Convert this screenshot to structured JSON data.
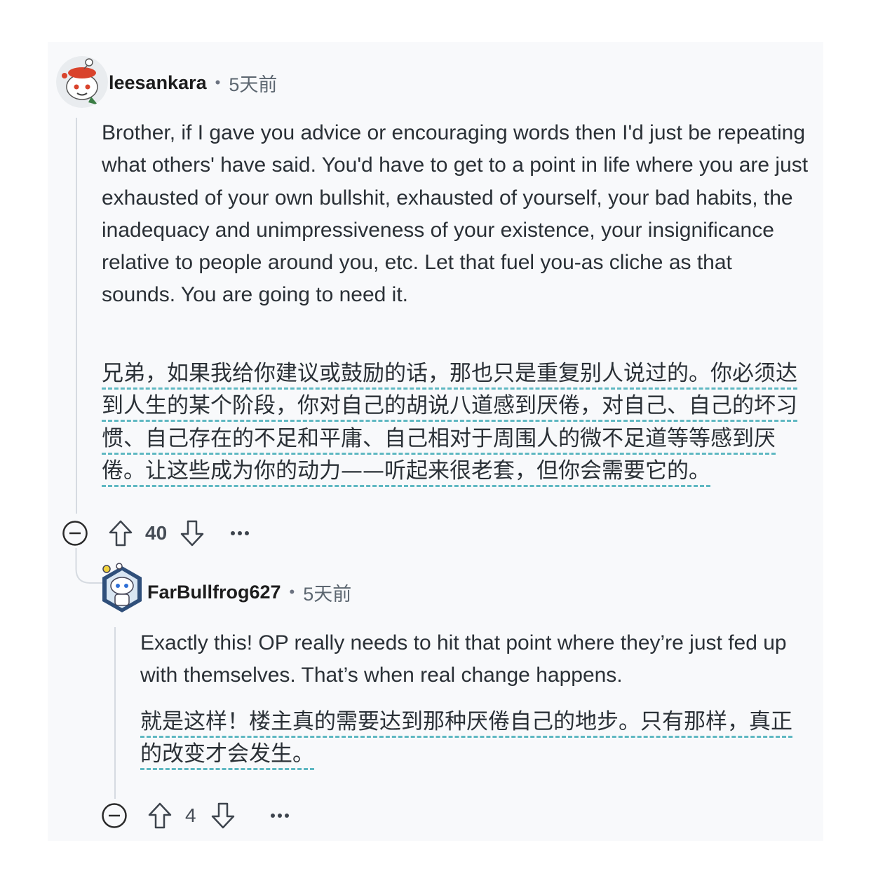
{
  "comments": [
    {
      "username": "leesankara",
      "separator": "•",
      "time": "5天前",
      "body_en": "Brother, if I gave you advice or encouraging words then I'd just be repeating what others' have said. You'd have to get to a point in life where you are just exhausted of your own bullshit, exhausted of yourself, your bad habits, the inadequacy and unimpressiveness of your existence, your insignificance relative to people around you, etc. Let that fuel you-as cliche as that sounds. You are going to need it.",
      "body_zh": "兄弟，如果我给你建议或鼓励的话，那也只是重复别人说过的。你必须达到人生的某个阶段，你对自己的胡说八道感到厌倦，对自己、自己的坏习惯、自己存在的不足和平庸、自己相对于周围人的微不足道等等感到厌倦。让这些成为你的动力——听起来很老套，但你会需要它的。",
      "vote_count": "40",
      "collapse_icon": "collapse-minus-icon",
      "more_icon": "more-dots-icon"
    },
    {
      "username": "FarBullfrog627",
      "separator": "•",
      "time": "5天前",
      "body_en": "Exactly this! OP really needs to hit that point where they’re just fed up with themselves. That’s when real change happens.",
      "body_zh": "就是这样！楼主真的需要达到那种厌倦自己的地步。只有那样，真正的改变才会发生。",
      "vote_count": "4",
      "collapse_icon": "collapse-minus-icon",
      "more_icon": "more-dots-icon"
    }
  ],
  "colors": {
    "card_bg": "#f8f9fb",
    "text": "#2a3036",
    "translation_underline": "#5fb8c2",
    "thread_line": "#d6dbe1"
  }
}
